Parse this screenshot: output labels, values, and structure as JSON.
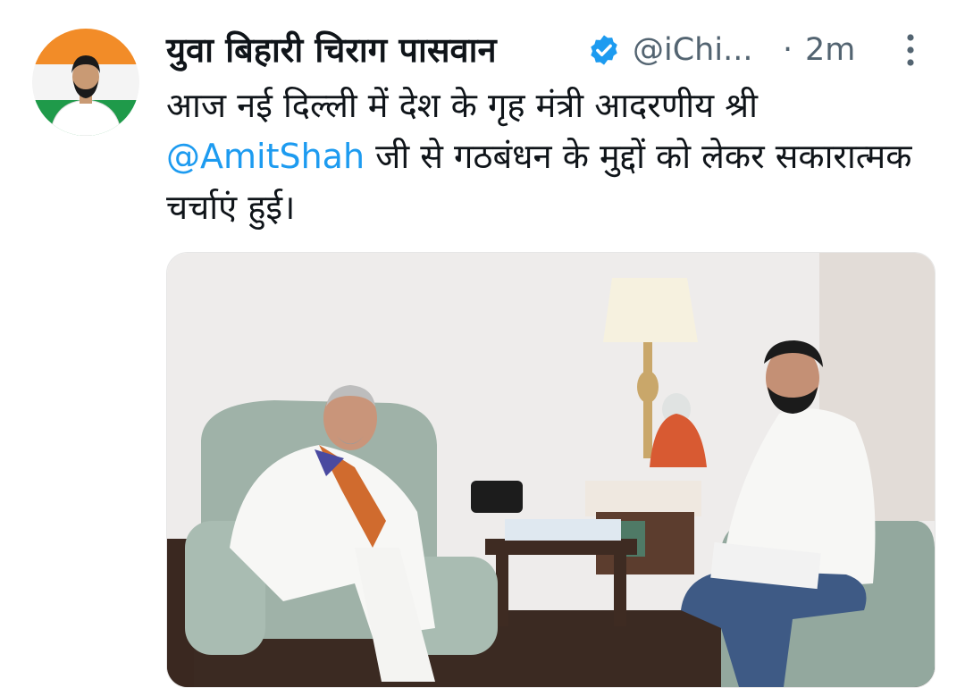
{
  "tweet": {
    "display_name": "युवा बिहारी चिराग पासवान",
    "handle": "@iChi...",
    "separator": "·",
    "timestamp": "2m",
    "text_before_mention": "आज नई दिल्ली में देश के गृह मंत्री आदरणीय श्री ",
    "mention": "@AmitShah",
    "text_after_mention": " जी से गठबंधन के मुद्दों को लेकर सकारात्मक चर्चाएं हुई।"
  },
  "icons": {
    "verified": "verified-badge-icon",
    "more": "more-vertical-icon"
  },
  "colors": {
    "link": "#1d9bf0",
    "verified": "#1d9bf0",
    "secondary_text": "#536471",
    "flag_saffron": "#f28c28",
    "flag_green": "#1f9a4a"
  }
}
